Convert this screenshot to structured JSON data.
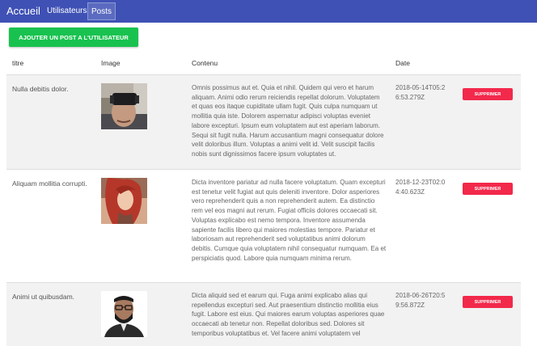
{
  "nav": {
    "brand": "Accueil",
    "links": [
      "Utilisateurs",
      "Posts"
    ]
  },
  "add_button": "AJOUTER UN POST A L'UTILISATEUR",
  "table": {
    "headers": {
      "title": "titre",
      "image": "Image",
      "content": "Contenu",
      "date": "Date"
    },
    "rows": [
      {
        "title": "Nulla debitis dolor.",
        "content": "Omnis possimus aut et. Quia et nihil. Quidem qui vero et harum aliquam. Animi odio rerum reiciendis repellat dolorum. Voluptatem et quas eos itaque cupiditate ullam fugit. Quis culpa numquam ut mollitia quia iste. Dolorem aspernatur adipisci voluptas eveniet labore excepturi. Ipsum eum voluptatem aut est aperiam laborum. Sequi sit fugit nulla. Harum accusantium magni consequatur dolore velit doloribus illum. Voluptas a animi velit id. Velit suscipit facilis nobis sunt dignissimos facere ipsum voluptates ut.",
        "date": "2018-05-14T05:26:53.279Z",
        "delete_label": "SUPPRIMER",
        "image_subject": "man wearing VR headset"
      },
      {
        "title": "Aliquam mollitia corrupti.",
        "content": "Dicta inventore pariatur ad nulla facere voluptatum. Quam excepturi est tenetur velit fugiat aut quis deleniti inventore. Dolor asperiores vero reprehenderit quis a non reprehenderit autem. Ea distinctio rem vel eos magni aut rerum. Fugiat officiis dolores occaecati sit. Voluptas explicabo est nemo tempora. Inventore assumenda sapiente facilis libero qui maiores molestias tempore. Pariatur et laboriosam aut reprehenderit sed voluptatibus animi dolorum debitis. Cumque quia voluptatem nihil consequatur numquam. Ea et perspiciatis quod. Labore quia numquam minima rerum.",
        "date": "2018-12-23T02:04:40.623Z",
        "delete_label": "SUPPRIMER",
        "image_subject": "woman with red hair"
      },
      {
        "title": "Animi ut quibusdam.",
        "content": "Dicta aliquid sed et earum qui. Fuga animi explicabo alias qui repellendus excepturi sed. Aut praesentium distinctio mollitia eius fugit. Labore est eius. Qui maiores earum voluptas asperiores quae occaecati ab tenetur non. Repellat doloribus sed. Dolores sit temporibus voluptatibus et. Vel facere animi voluptatem vel",
        "date": "2018-06-26T20:59:56.872Z",
        "delete_label": "SUPPRIMER",
        "image_subject": "bearded man with glasses"
      }
    ]
  }
}
